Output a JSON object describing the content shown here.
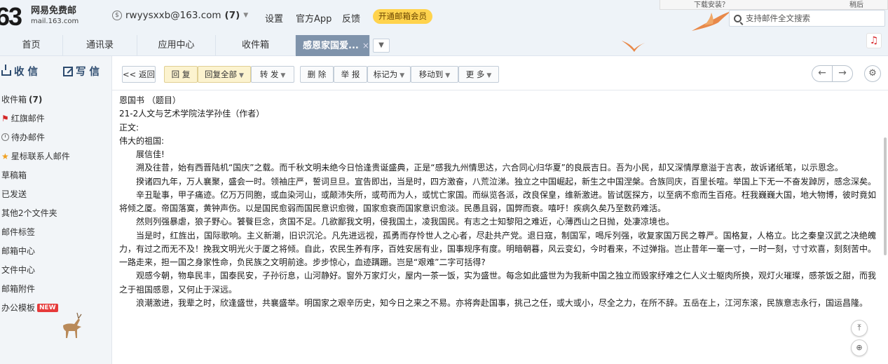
{
  "header": {
    "logo_num": "63",
    "logo_cn": "网易免费邮",
    "logo_en": "mail.163.com",
    "account": "rwyysxxb@163.com",
    "account_count": "(7)",
    "links": [
      "设置",
      "官方App",
      "反馈"
    ],
    "vip": "开通邮箱会员",
    "notice_text": "下载安装？",
    "notice_later": "稍后",
    "search_placeholder": "支持邮件全文搜索"
  },
  "tabs": [
    {
      "label": "首页"
    },
    {
      "label": "通讯录"
    },
    {
      "label": "应用中心"
    },
    {
      "label": "收件箱"
    },
    {
      "label": "感恩家国爱...",
      "active": true
    }
  ],
  "sidebar": {
    "receive": "收 信",
    "write": "写 信",
    "items": [
      {
        "label": "收件箱",
        "count": "(7)"
      },
      {
        "label": "红旗邮件"
      },
      {
        "label": "待办邮件"
      },
      {
        "label": "星标联系人邮件"
      },
      {
        "label": "草稿箱"
      },
      {
        "label": "已发送"
      },
      {
        "label": "其他2个文件夹"
      },
      {
        "label": "邮件标签"
      },
      {
        "label": "邮箱中心"
      },
      {
        "label": "文件中心"
      },
      {
        "label": "邮箱附件"
      },
      {
        "label": "办公模板",
        "badge": "NEW"
      }
    ]
  },
  "toolbar": {
    "back": "<< 返回",
    "reply": "回 复",
    "reply_all": "回复全部",
    "forward": "转 发",
    "delete": "删 除",
    "report": "举 报",
    "mark": "标记为",
    "move": "移动到",
    "more": "更 多"
  },
  "mail": {
    "lines": [
      "恩国书 （题目）",
      "21-2人文与艺术学院法学孙佳（作者）",
      "正文:",
      "伟大的祖国:"
    ],
    "paragraphs": [
      "展信佳!",
      "溯及往昔，始有西晋陆机“国庆”之载。而千秋文明未绝今日恰逢贵诞盛典，正是“感我九州情思达，六合同心归华夏”的良辰吉日。吾为小民，却又深情厚意溢于言表，故诉诸纸笔，以示恩念。",
      "揆诸四九年，万人襄聚，盛会一时。领袖庄严，誓词旦旦。宣告即出，当是时，四方激奋，八荒泣涕。独立之中国崛起，新生之中国涅槃。合族同庆，百里长喧。举国上下无一不奋发踔厉，感念深矣。",
      "辛丑耻事，甲子痛迹。亿万万同胞，或血染河山，或颠沛失所，或苟而为人，或忧亡家国。而纵览各派，改良保皇，维新激进。皆试医探方，以至病不愈而生百疮。枉我巍巍大国，地大物博，彼时竟如将倾之厦。帝国落寞，黄钟声伤。以是国民愈弱而国民意识愈微，国家愈衰而国家意识愈淡。民愚且弱，国弊而衰。嘻吁！疾病久矣乃至数药难活。",
      "然则列强暴虐，狼子野心。饕餮巨念，贪国不足。几欲鄙我文明，侵我国土，凌我国民。有志之士知黎阳之难近，心薄西山之日抛，处凄凉境也。",
      "当是时，红旌出，国际歌响。主义新潮，旧识沉沦。凡先进远视，孤勇而存怜世人之心者，尽赴共产党。退日寇，制国军，喝斥列强，收复家国万民之尊严。国格复，人格立。比之秦皇汉武之决绝魄力，有过之而无不及！挽我文明光火于厦之将倾。自此，农民生养有序，百姓安居有业，国事规序有度。明暗朝暮，风云变幻，今时看来，不过弹指。岂止昔年一毫一寸，一时一刻，寸寸欢喜，刻刻苦中。一路走来，担一国之身家性命，负民族之文明前途。步步惊心，血迹蹒跚。岂是“艰难”二字可括得?",
      "观感今朝，物阜民丰，国泰民安，子孙衍息，山河静好。窗外万家灯火，屋内一茶一饭，实为盛世。每念如此盛世为为我新中国之独立而毁家纾难之仁人义士躯肉所换，观灯火璀璨，感茶饭之甜，而我之于祖国感恩，又何止于深远。",
      "浪潮激进，我辈之时，欣逢盛世，共襄盛举。明国家之艰辛历史，知今日之来之不易。亦将奔赴国事，挑己之任，或大或小，尽全之力，在所不辞。五岳在上，江河东滚，民族意志永行，国运昌隆。"
    ]
  },
  "colors": {
    "active_tab": "#7f93ab",
    "vip": "#ffd34d",
    "highlight_btn": "#fcf3cf",
    "flag": "#d32626",
    "star": "#f0a020"
  }
}
